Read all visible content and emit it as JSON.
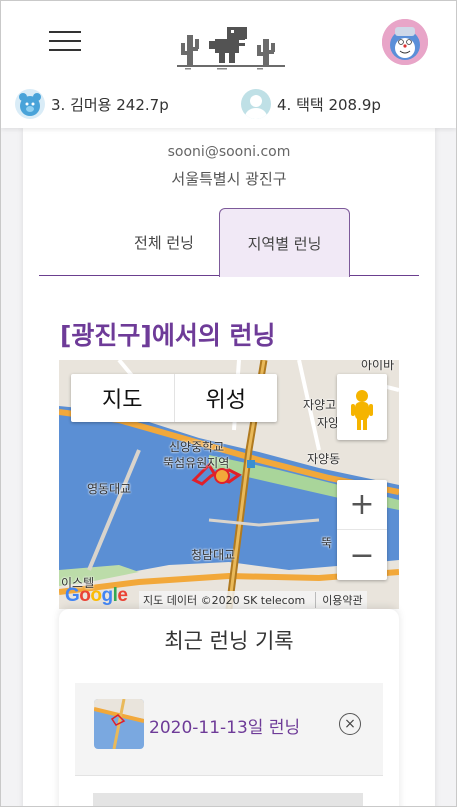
{
  "header": {
    "logo": "t-rex-dino-logo",
    "leaderboard": [
      {
        "rank_label": "3. 김머용 242.7p",
        "avatar": "blue-bear-avatar"
      },
      {
        "rank_label": "4. 택택 208.9p",
        "avatar": "default-user-avatar"
      }
    ]
  },
  "profile": {
    "email": "sooni@sooni.com",
    "region": "서울특별시 광진구"
  },
  "tabs": [
    {
      "label": "전체 런닝",
      "active": false
    },
    {
      "label": "지역별 런닝",
      "active": true
    }
  ],
  "section_title": "[광진구]에서의 런닝",
  "map": {
    "type_buttons": [
      "지도",
      "위성"
    ],
    "zoom_in": "+",
    "zoom_out": "−",
    "labels": {
      "school": "신양중학교",
      "park": "뚝섬유원지역",
      "jayang": "자양동",
      "jayang_top": "자양고",
      "jayang_mid": "자양",
      "bridge1": "영동대교",
      "bridge2": "청담대교",
      "ttuk": "뚝",
      "hotel": "이스텔",
      "top_right": "아이바"
    },
    "google_logo": "Google",
    "attribution": "지도 데이터 ©2020 SK telecom",
    "terms": "이용약관"
  },
  "recent": {
    "title": "최근 런닝 기록",
    "records": [
      {
        "label": "2020-11-13일 런닝",
        "delete_symbol": "×"
      }
    ]
  },
  "colors": {
    "accent": "#6e3b98",
    "tab_active_bg": "#f1e9f6",
    "route": "#e0202a"
  }
}
